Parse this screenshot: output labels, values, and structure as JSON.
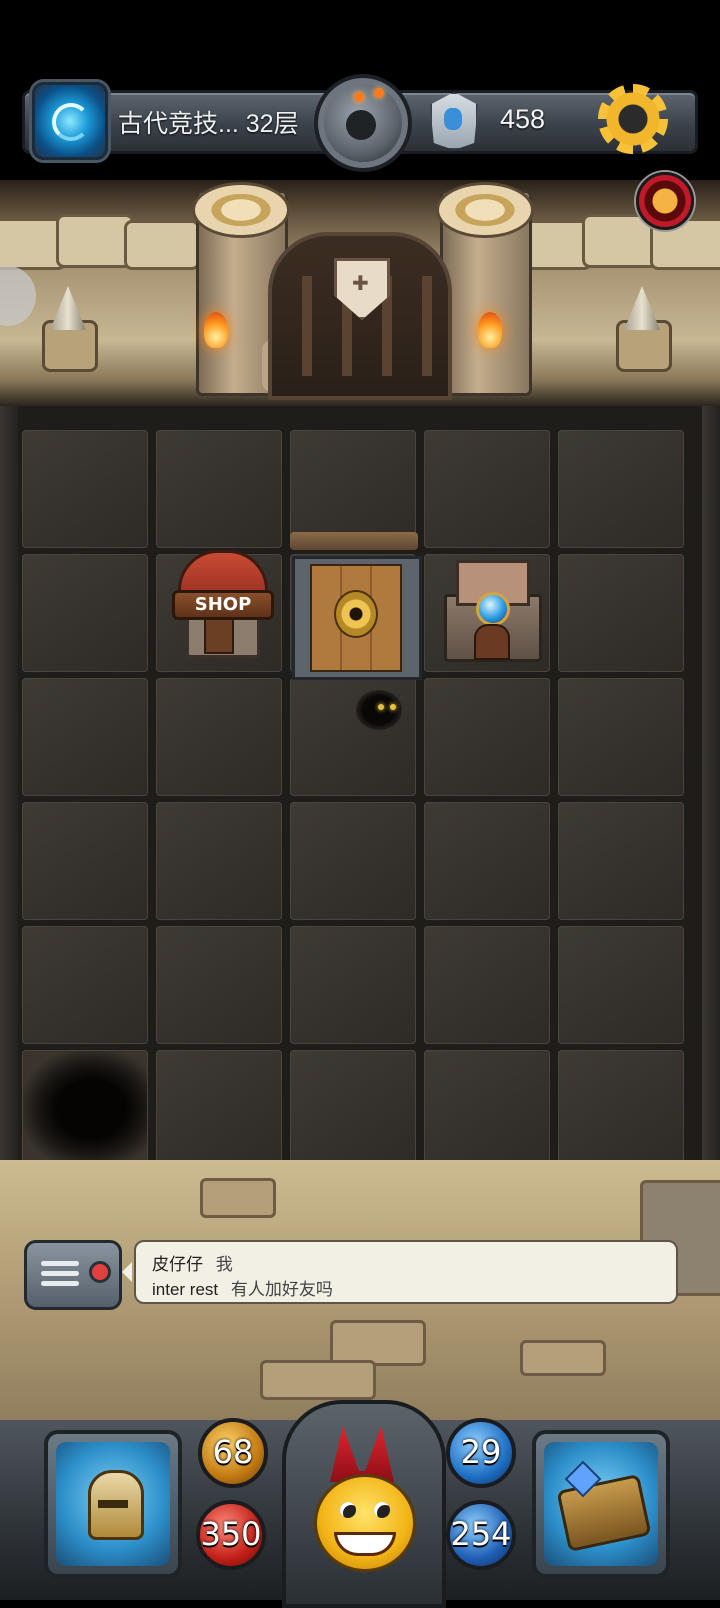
{
  "header": {
    "level_text": "古代竞技... 32层",
    "key_count": "458"
  },
  "icons": {
    "portal": "portal-swirl-icon",
    "bomb": "bomb-icon",
    "key": "key-shield-icon",
    "settings": "gear-icon",
    "avatar": "monkey-avatar-icon",
    "chat": "chat-icon"
  },
  "board": {
    "objects": {
      "shop_sign": "SHOP",
      "locked_door": "locked-door",
      "altar": "blue-orb-altar",
      "enemy": "shadow-creature"
    }
  },
  "chat": {
    "messages": [
      {
        "name": "皮仔仔",
        "text": "我"
      },
      {
        "name": "inter rest",
        "text": "有人加好友吗"
      }
    ]
  },
  "stats": {
    "attack": "68",
    "hp": "350",
    "defense": "29",
    "mp": "254"
  },
  "colors": {
    "attack": "#c27a12",
    "hp": "#c22018",
    "defense": "#1f6fc4",
    "accent_gold": "#f7c23a"
  }
}
